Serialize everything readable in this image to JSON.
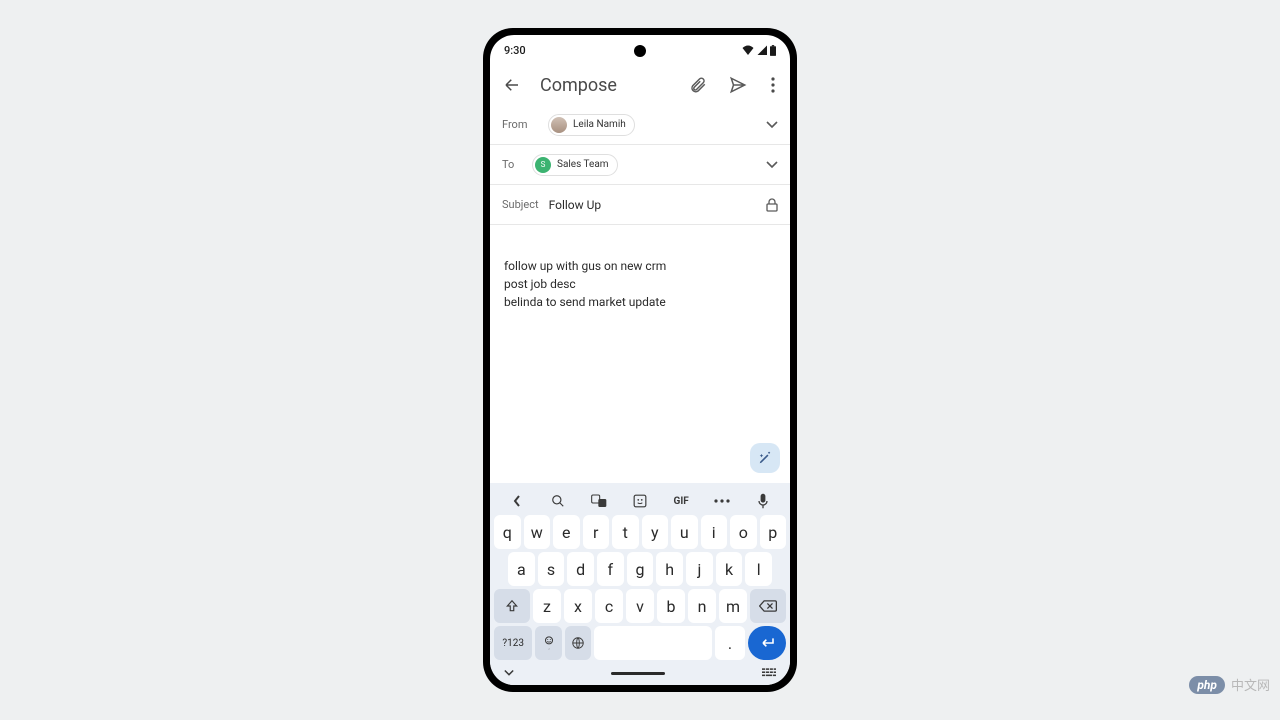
{
  "status": {
    "time": "9:30"
  },
  "header": {
    "title": "Compose"
  },
  "from": {
    "label": "From",
    "name": "Leila Namih"
  },
  "to": {
    "label": "To",
    "initial": "S",
    "name": "Sales Team"
  },
  "subject": {
    "label": "Subject",
    "value": "Follow Up"
  },
  "body": "follow up with gus on new crm\npost job desc\nbelinda to send market update",
  "keyboard": {
    "row1": [
      "q",
      "w",
      "e",
      "r",
      "t",
      "y",
      "u",
      "i",
      "o",
      "p"
    ],
    "row2": [
      "a",
      "s",
      "d",
      "f",
      "g",
      "h",
      "j",
      "k",
      "l"
    ],
    "row3": [
      "z",
      "x",
      "c",
      "v",
      "b",
      "n",
      "m"
    ],
    "symbols": "?123",
    "period": "."
  },
  "toolbar": {
    "gif": "GIF"
  },
  "watermark": {
    "php": "php",
    "text": "中文网"
  }
}
